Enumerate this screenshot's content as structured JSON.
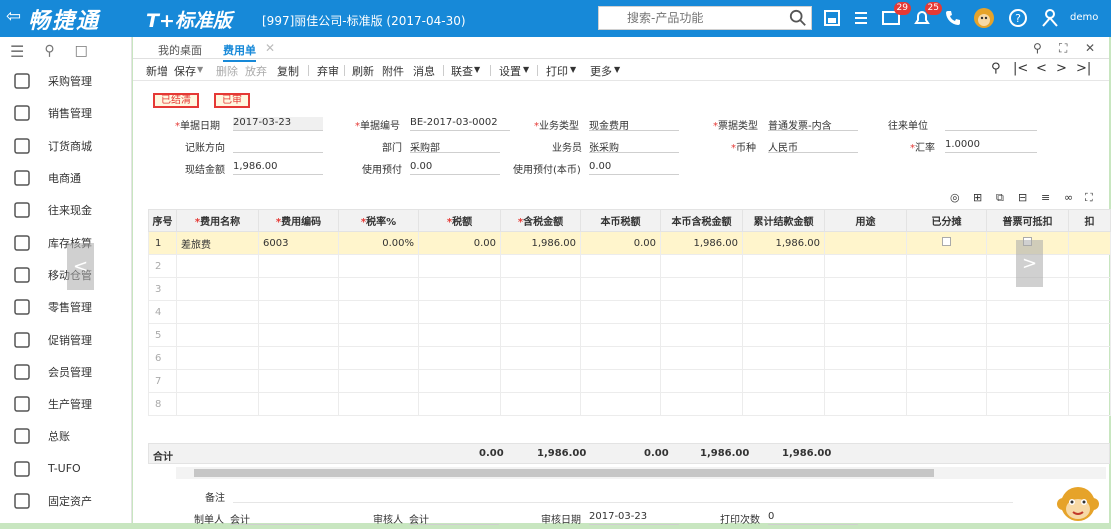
{
  "app": {
    "back_icon": "back-icon",
    "brand": "畅捷通",
    "product": "T+标准版",
    "company": "[997]丽佳公司-标准版 (2017-04-30)",
    "search_placeholder": "搜索-产品功能",
    "badge_1": "29",
    "badge_2": "25",
    "user": "demo"
  },
  "sidebar": {
    "items": [
      {
        "label": "采购管理",
        "icon": "purchase-icon"
      },
      {
        "label": "销售管理",
        "icon": "sales-icon"
      },
      {
        "label": "订货商城",
        "icon": "store-icon"
      },
      {
        "label": "电商通",
        "icon": "ecommerce-icon"
      },
      {
        "label": "往来现金",
        "icon": "cash-icon"
      },
      {
        "label": "库存核算",
        "icon": "inventory-icon"
      },
      {
        "label": "移动仓管",
        "icon": "mobile-warehouse-icon"
      },
      {
        "label": "零售管理",
        "icon": "retail-icon"
      },
      {
        "label": "促销管理",
        "icon": "promotion-icon"
      },
      {
        "label": "会员管理",
        "icon": "member-icon"
      },
      {
        "label": "生产管理",
        "icon": "production-icon"
      },
      {
        "label": "总账",
        "icon": "ledger-icon"
      },
      {
        "label": "T-UFO",
        "icon": "ufo-icon"
      },
      {
        "label": "固定资产",
        "icon": "asset-icon"
      }
    ]
  },
  "tabs": {
    "desktop": "我的桌面",
    "expense": "费用单"
  },
  "toolbar": {
    "new": "新增",
    "save": "保存",
    "delete": "删除",
    "abandon": "放弃",
    "copy": "复制",
    "unaudit": "弃审",
    "refresh": "刷新",
    "attach": "附件",
    "message": "消息",
    "link": "联查",
    "settings": "设置",
    "print": "打印",
    "more": "更多"
  },
  "stamps": {
    "settled": "已结清",
    "audited": "已审"
  },
  "form": {
    "date_label": "单据日期",
    "date": "2017-03-23",
    "code_label": "单据编号",
    "code": "BE-2017-03-0002",
    "biztype_label": "业务类型",
    "biztype": "现金费用",
    "invtype_label": "票据类型",
    "invtype": "普通发票-内含",
    "partner_label": "往来单位",
    "partner": "",
    "direction_label": "记账方向",
    "direction": "",
    "dept_label": "部门",
    "dept": "采购部",
    "staff_label": "业务员",
    "staff": "张采购",
    "currency_label": "币种",
    "currency": "人民币",
    "rate_label": "汇率",
    "rate": "1.0000",
    "settle_label": "现结金额",
    "settle": "1,986.00",
    "prepay_label": "使用预付",
    "prepay": "0.00",
    "prepay_base_label": "使用预付(本币)",
    "prepay_base": "0.00"
  },
  "grid": {
    "headers": {
      "seq": "序号",
      "name": "费用名称",
      "code": "费用编码",
      "rate": "税率%",
      "tax": "税额",
      "total": "含税金额",
      "base_tax": "本币税额",
      "base_total": "本币含税金额",
      "settled": "累计结款金额",
      "usage": "用途",
      "allocated": "已分摊",
      "deduct": "普票可抵扣",
      "extra": "扣"
    },
    "row1": {
      "seq": "1",
      "name": "差旅费",
      "code": "6003",
      "rate": "0.00%",
      "tax": "0.00",
      "total": "1,986.00",
      "base_tax": "0.00",
      "base_total": "1,986.00",
      "settled": "1,986.00"
    },
    "empty_rows": [
      "2",
      "3",
      "4",
      "5",
      "6",
      "7",
      "8"
    ]
  },
  "totals": {
    "label": "合计",
    "tax": "0.00",
    "total": "1,986.00",
    "base_tax": "0.00",
    "base_total": "1,986.00",
    "settled": "1,986.00"
  },
  "footer": {
    "remark_label": "备注",
    "remark": "",
    "maker_label": "制单人",
    "maker": "会计",
    "auditor_label": "审核人",
    "auditor": "会计",
    "audit_date_label": "审核日期",
    "audit_date": "2017-03-23",
    "print_count_label": "打印次数",
    "print_count": "0"
  },
  "colors": {
    "accent": "#1789d8",
    "required": "#e53935",
    "selected_row": "#fff5cc"
  }
}
